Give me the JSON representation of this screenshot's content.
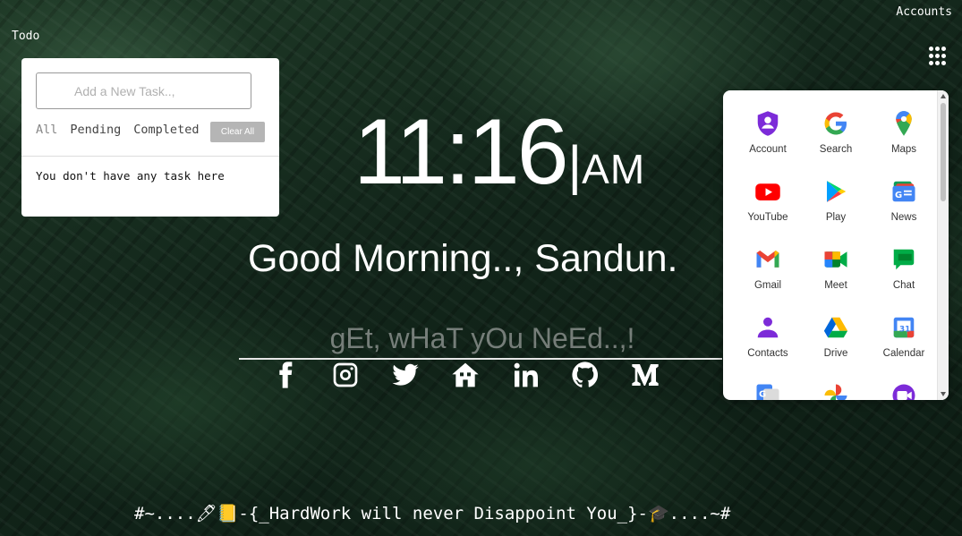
{
  "header": {
    "todo_label": "Todo",
    "accounts_label": "Accounts",
    "apps_button_icon": "grid-dots-icon"
  },
  "todo": {
    "input_placeholder": "Add a New Task..,",
    "filters": [
      "All",
      "Pending",
      "Completed"
    ],
    "active_filter": "All",
    "clear_label": "Clear All",
    "empty_message": "You don't have any task here"
  },
  "clock": {
    "time": "11:16",
    "separator": "|",
    "ampm": "AM"
  },
  "greeting": "Good Morning.., Sandun.",
  "search": {
    "placeholder": "gEt, wHaT yOu NeEd..,!"
  },
  "socials": [
    {
      "name": "facebook-icon"
    },
    {
      "name": "instagram-icon"
    },
    {
      "name": "twitter-icon"
    },
    {
      "name": "home-icon"
    },
    {
      "name": "linkedin-icon"
    },
    {
      "name": "github-icon"
    },
    {
      "name": "medium-icon"
    }
  ],
  "apps": [
    {
      "label": "Account",
      "icon": "account-icon"
    },
    {
      "label": "Search",
      "icon": "google-search-icon"
    },
    {
      "label": "Maps",
      "icon": "maps-icon"
    },
    {
      "label": "YouTube",
      "icon": "youtube-icon"
    },
    {
      "label": "Play",
      "icon": "play-icon"
    },
    {
      "label": "News",
      "icon": "news-icon"
    },
    {
      "label": "Gmail",
      "icon": "gmail-icon"
    },
    {
      "label": "Meet",
      "icon": "meet-icon"
    },
    {
      "label": "Chat",
      "icon": "chat-icon"
    },
    {
      "label": "Contacts",
      "icon": "contacts-icon"
    },
    {
      "label": "Drive",
      "icon": "drive-icon"
    },
    {
      "label": "Calendar",
      "icon": "calendar-icon"
    }
  ],
  "quote": "#~....🖊📒-{_HardWork will never Disappoint You_}-🎓....~#"
}
